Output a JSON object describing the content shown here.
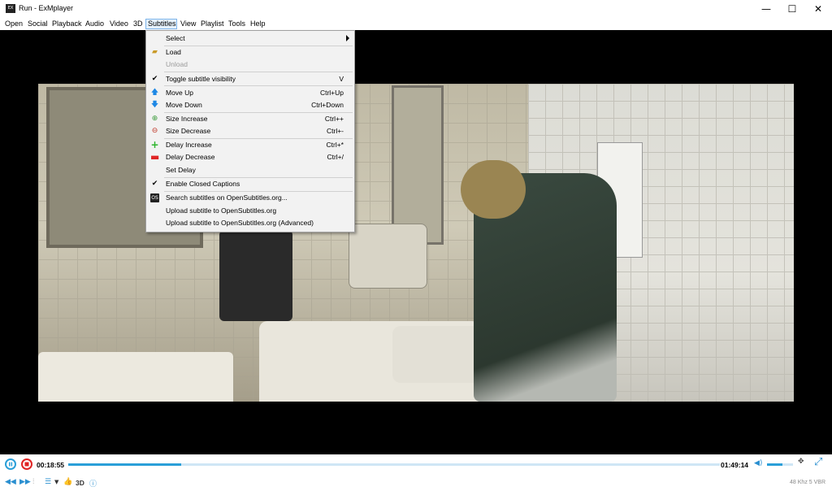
{
  "window": {
    "app_icon_text": "EX",
    "title": "Run - ExMplayer",
    "minimize": "—",
    "maximize": "☐",
    "close": "✕"
  },
  "menubar": [
    {
      "label": "Open"
    },
    {
      "label": "Social"
    },
    {
      "label": "Playback"
    },
    {
      "label": "Audio"
    },
    {
      "label": "Video"
    },
    {
      "label": "3D"
    },
    {
      "label": "Subtitles"
    },
    {
      "label": "View"
    },
    {
      "label": "Playlist"
    },
    {
      "label": "Tools"
    },
    {
      "label": "Help"
    }
  ],
  "subtitles_menu": {
    "items": [
      {
        "label": "Select",
        "shortcut": "",
        "icon": "submenu"
      },
      {
        "label": "Load",
        "shortcut": "",
        "icon": "folder-icon"
      },
      {
        "label": "Unload",
        "shortcut": "",
        "icon": ""
      },
      {
        "label": "Toggle subtitle visibility",
        "shortcut": "V",
        "icon": "checkmark-icon"
      },
      {
        "label": "Move Up",
        "shortcut": "Ctrl+Up",
        "icon": "arrow-up-icon"
      },
      {
        "label": "Move Down",
        "shortcut": "Ctrl+Down",
        "icon": "arrow-down-icon"
      },
      {
        "label": "Size Increase",
        "shortcut": "Ctrl++",
        "icon": "zoom-in-icon"
      },
      {
        "label": "Size Decrease",
        "shortcut": "Ctrl+-",
        "icon": "zoom-out-icon"
      },
      {
        "label": "Delay Increase",
        "shortcut": "Ctrl+*",
        "icon": "plus-icon"
      },
      {
        "label": "Delay Decrease",
        "shortcut": "Ctrl+/",
        "icon": "minus-icon"
      },
      {
        "label": "Set Delay",
        "shortcut": "",
        "icon": ""
      },
      {
        "label": "Enable Closed Captions",
        "shortcut": "",
        "icon": "checkmark-icon"
      },
      {
        "label": "Search subtitles on OpenSubtitles.org...",
        "shortcut": "",
        "icon": "opensubtitles-icon"
      },
      {
        "label": "Upload subtitle to OpenSubtitles.org",
        "shortcut": "",
        "icon": ""
      },
      {
        "label": "Upload subtitle to OpenSubtitles.org (Advanced)",
        "shortcut": "",
        "icon": ""
      }
    ]
  },
  "player": {
    "current_time": "00:18:55",
    "total_time": "01:49:14",
    "progress": 0.173,
    "volume": 0.6,
    "mode_3d_label": "3D",
    "audio_info": "48 Khz 5 VBR"
  },
  "colors": {
    "accent": "#2a9fd8",
    "stop_red": "#e02424",
    "menu_highlight": "#e5f1fb"
  }
}
